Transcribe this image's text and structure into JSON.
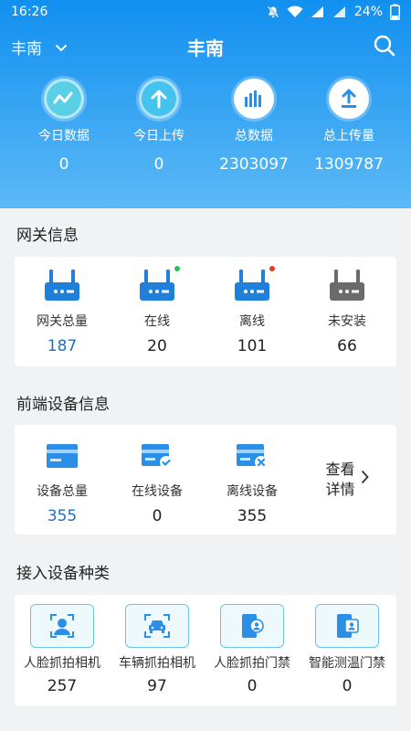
{
  "status_bar": {
    "time": "16:26",
    "battery": "24%"
  },
  "header": {
    "region": "丰南",
    "title": "丰南"
  },
  "stats": [
    {
      "label": "今日数据",
      "value": "0",
      "icon": "trend-wave-icon"
    },
    {
      "label": "今日上传",
      "value": "0",
      "icon": "upload-arrow-icon"
    },
    {
      "label": "总数据",
      "value": "2303097",
      "icon": "bar-chart-icon"
    },
    {
      "label": "总上传量",
      "value": "1309787",
      "icon": "upload-tray-icon"
    }
  ],
  "gateway": {
    "title": "网关信息",
    "items": [
      {
        "label": "网关总量",
        "value": "187",
        "icon": "router-icon"
      },
      {
        "label": "在线",
        "value": "20",
        "icon": "router-online-icon"
      },
      {
        "label": "离线",
        "value": "101",
        "icon": "router-offline-icon"
      },
      {
        "label": "未安装",
        "value": "66",
        "icon": "router-uninstalled-icon"
      }
    ],
    "colors": {
      "blue": "#1f7fd9",
      "gray": "#6b6b6b",
      "online": "#22c55e",
      "offline": "#e53935"
    }
  },
  "frontend": {
    "title": "前端设备信息",
    "items": [
      {
        "label": "设备总量",
        "value": "355",
        "icon": "card-icon"
      },
      {
        "label": "在线设备",
        "value": "0",
        "icon": "card-check-icon"
      },
      {
        "label": "离线设备",
        "value": "355",
        "icon": "card-x-icon"
      }
    ],
    "detail_link": {
      "line1": "查看",
      "line2": "详情"
    }
  },
  "device_types": {
    "title": "接入设备种类",
    "items": [
      {
        "label": "人脸抓拍相机",
        "value": "257",
        "icon": "face-camera-icon"
      },
      {
        "label": "车辆抓拍相机",
        "value": "97",
        "icon": "vehicle-camera-icon"
      },
      {
        "label": "人脸抓拍门禁",
        "value": "0",
        "icon": "face-gate-icon"
      },
      {
        "label": "智能测温门禁",
        "value": "0",
        "icon": "temperature-gate-icon"
      }
    ]
  },
  "accent_color": "#1190f0"
}
